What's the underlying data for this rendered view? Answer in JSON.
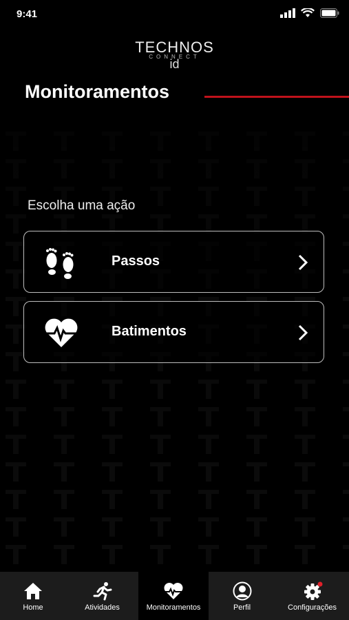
{
  "status_bar": {
    "time": "9:41"
  },
  "logo": {
    "line1": "TECHNOS",
    "line2": "CONNECT",
    "line3": "id"
  },
  "header": {
    "title": "Monitoramentos",
    "accent_color": "#c0121b"
  },
  "prompt": "Escolha uma ação",
  "actions": [
    {
      "label": "Passos",
      "icon": "footprints-icon"
    },
    {
      "label": "Batimentos",
      "icon": "heart-rate-icon"
    }
  ],
  "tabbar": {
    "items": [
      {
        "label": "Home",
        "icon": "home-icon"
      },
      {
        "label": "Atividades",
        "icon": "runner-icon"
      },
      {
        "label": "Monitoramentos",
        "icon": "heart-rate-icon",
        "active": true
      },
      {
        "label": "Perfil",
        "icon": "user-icon"
      },
      {
        "label": "Configurações",
        "icon": "gear-icon",
        "badge_color": "#e0202a"
      }
    ]
  }
}
